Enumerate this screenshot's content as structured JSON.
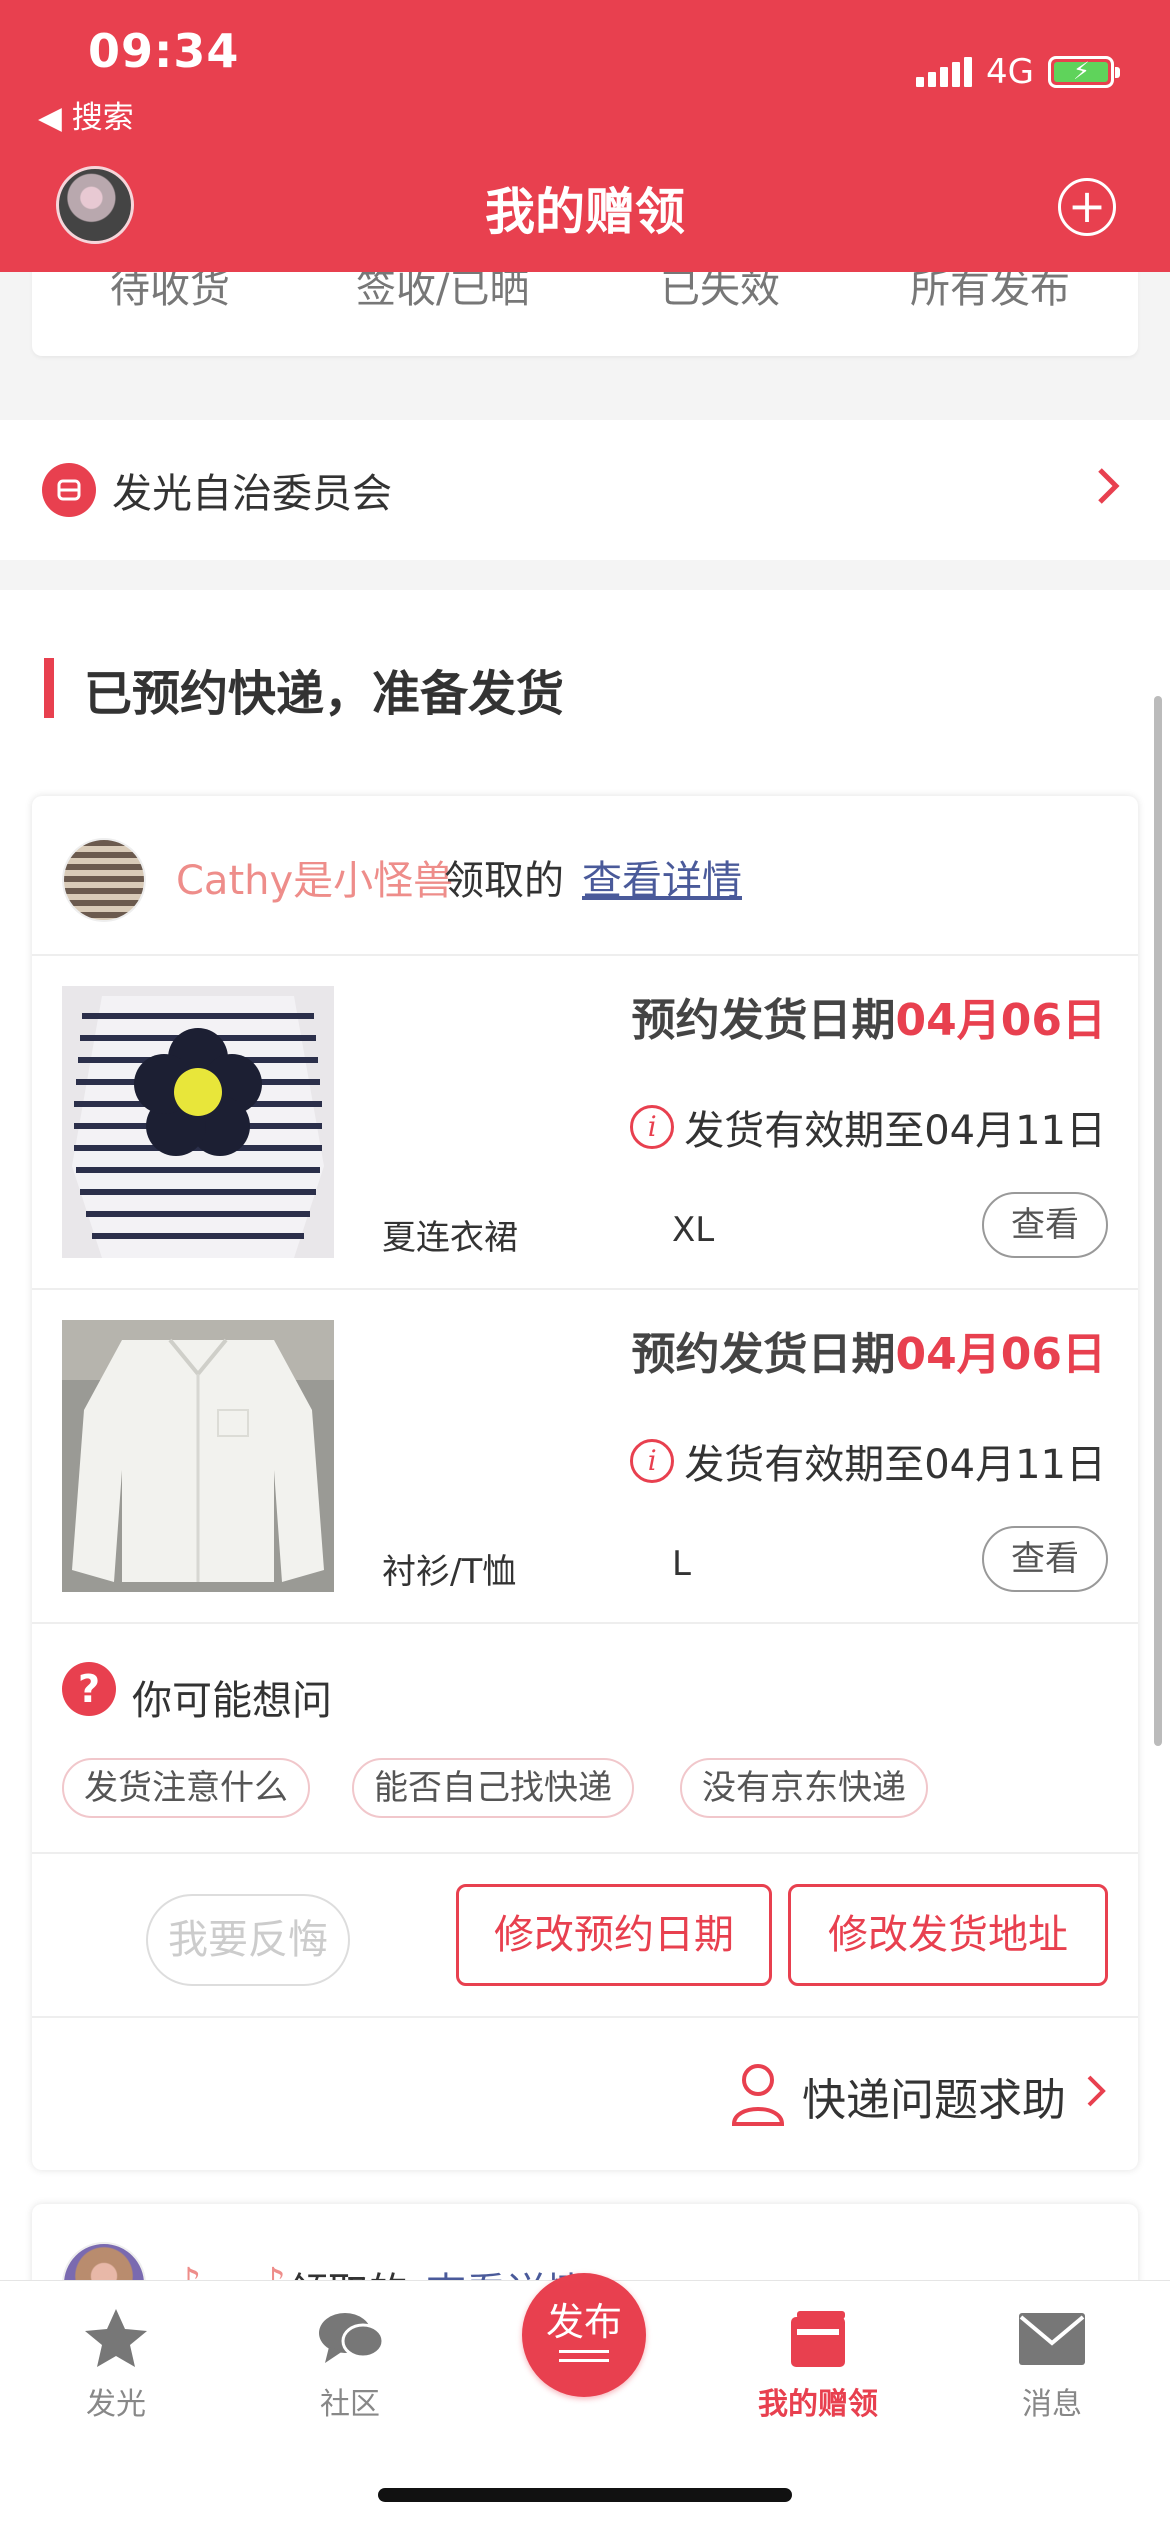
{
  "status_bar": {
    "time": "09:34",
    "back_label": "搜索",
    "network": "4G"
  },
  "header": {
    "title": "我的赠领"
  },
  "top_tabs": [
    "待收货",
    "签收/已晒",
    "已失效",
    "所有发布"
  ],
  "committee": {
    "label": "发光自治委员会"
  },
  "section": {
    "title": "已预约快递，准备发货"
  },
  "card": {
    "claimer": "Cathy是小怪兽",
    "claimed_text": "领取的",
    "detail_link": "查看详情",
    "items": [
      {
        "date_label": "预约发货日期",
        "date_value": "04月06日",
        "valid_text": "发货有效期至04月11日",
        "name": "夏连衣裙",
        "size": "XL",
        "view_label": "查看"
      },
      {
        "date_label": "预约发货日期",
        "date_value": "04月06日",
        "valid_text": "发货有效期至04月11日",
        "name": "衬衫/T恤",
        "size": "L",
        "view_label": "查看"
      }
    ],
    "faq": {
      "title": "你可能想问",
      "chips": [
        "发货注意什么",
        "能否自己找快递",
        "没有京东快递"
      ]
    },
    "actions": {
      "regret": "我要反悔",
      "modify_date": "修改预约日期",
      "modify_address": "修改发货地址"
    },
    "help": {
      "label": "快递问题求助"
    }
  },
  "card2": {
    "claimer": "♪ ~ ♪",
    "claimed_text": "领取的",
    "detail_link": "查看详情"
  },
  "tabbar": {
    "items": [
      {
        "label": "发光",
        "icon": "star-icon"
      },
      {
        "label": "社区",
        "icon": "chat-bubbles-icon"
      },
      {
        "label": "发布",
        "icon": "publish-icon"
      },
      {
        "label": "我的赠领",
        "icon": "gift-box-icon"
      },
      {
        "label": "消息",
        "icon": "envelope-icon"
      }
    ],
    "active": "我的赠领"
  },
  "colors": {
    "brand": "#e8404f",
    "claimer_name": "#ee8d8a",
    "link": "#4a5a9a"
  }
}
